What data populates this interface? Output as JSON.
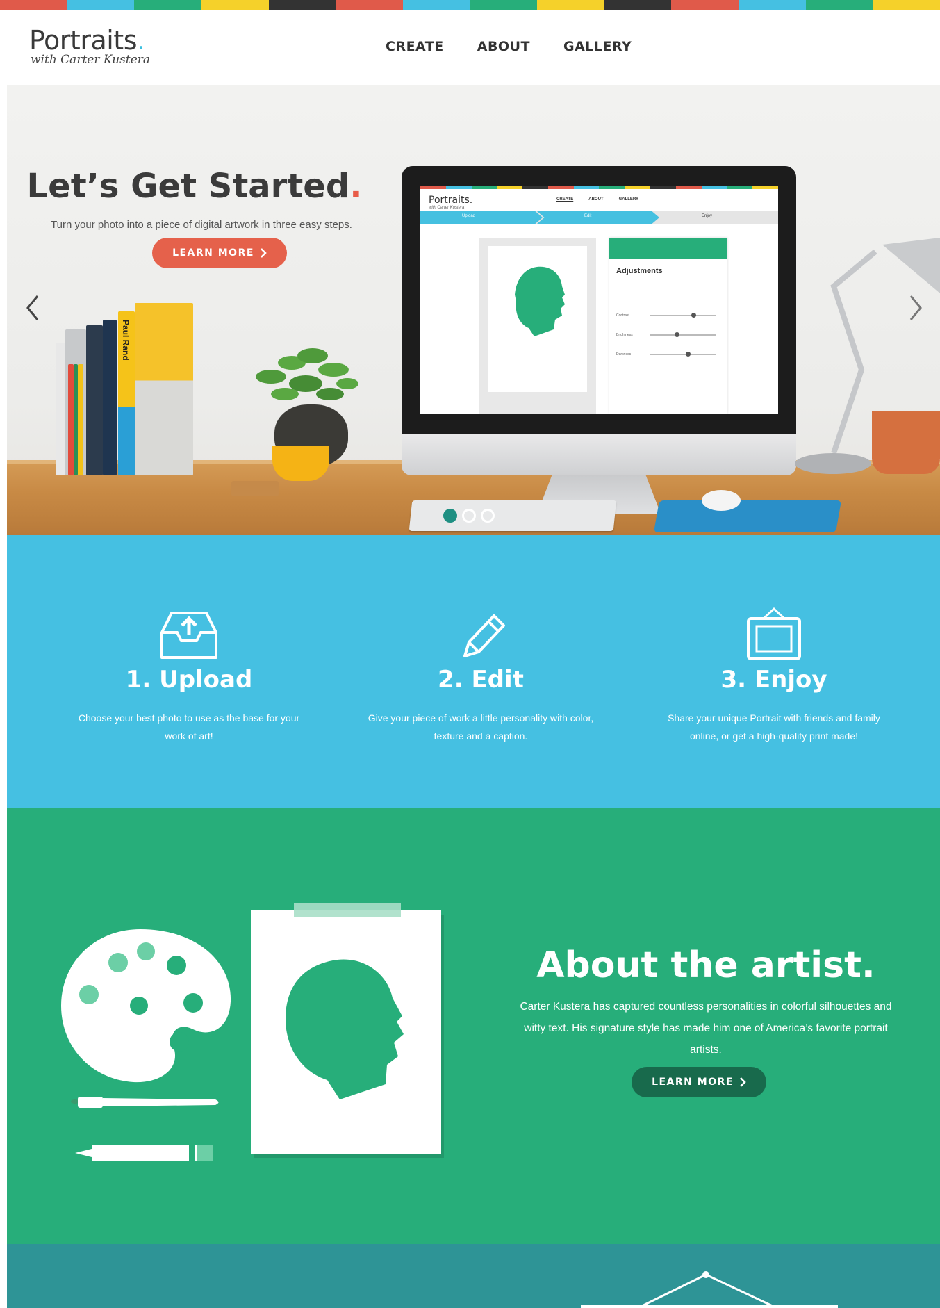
{
  "colors": {
    "stripe": [
      "#e05a4a",
      "#45c0e2",
      "#27ae7a",
      "#f5d12a",
      "#333333",
      "#e05a4a",
      "#45c0e2",
      "#27ae7a",
      "#f5d12a",
      "#333333",
      "#e05a4a",
      "#45c0e2",
      "#27ae7a",
      "#f5d12a"
    ],
    "accent_red": "#e5614b",
    "blue": "#45c0e2",
    "green": "#27ae7a",
    "teal": "#2e9496"
  },
  "header": {
    "logo_title": "Portraits",
    "logo_dot": ".",
    "logo_sub": "with Carter Kustera",
    "nav": [
      "CREATE",
      "ABOUT",
      "GALLERY"
    ]
  },
  "hero": {
    "title": "Let’s Get Started",
    "title_dot": ".",
    "subtitle": "Turn your photo into a piece of digital artwork in three easy steps.",
    "button": "LEARN MORE",
    "button_icon": "chevron-right-icon",
    "prev_icon": "chevron-left-icon",
    "next_icon": "chevron-right-icon",
    "book_label": "Paul Rand",
    "slides_total": 3,
    "slide_active": 1,
    "screen": {
      "logo": "Portraits.",
      "logo_sub": "with Carter Kustera",
      "nav": [
        "CREATE",
        "ABOUT",
        "GALLERY"
      ],
      "steps": [
        "Upload",
        "Edit",
        "Enjoy"
      ],
      "panel_title": "Adjustments",
      "sliders": [
        "Contrast",
        "Brightness",
        "Darkness"
      ]
    }
  },
  "steps": [
    {
      "title": "1. Upload",
      "text": "Choose your best photo to use as the base for your work of art!",
      "icon": "upload-tray-icon"
    },
    {
      "title": "2. Edit",
      "text": "Give your piece of work a little personality with color, texture and a caption.",
      "icon": "pencil-icon"
    },
    {
      "title": "3. Enjoy",
      "text": "Share your unique Portrait with friends and family online, or get a high-quality print made!",
      "icon": "hanging-frame-icon"
    }
  ],
  "about": {
    "title": "About the artist.",
    "text": "Carter Kustera has captured countless personalities in colorful silhouettes and witty text. His signature style has made him one of America’s favorite portrait artists.",
    "button": "LEARN MORE"
  }
}
